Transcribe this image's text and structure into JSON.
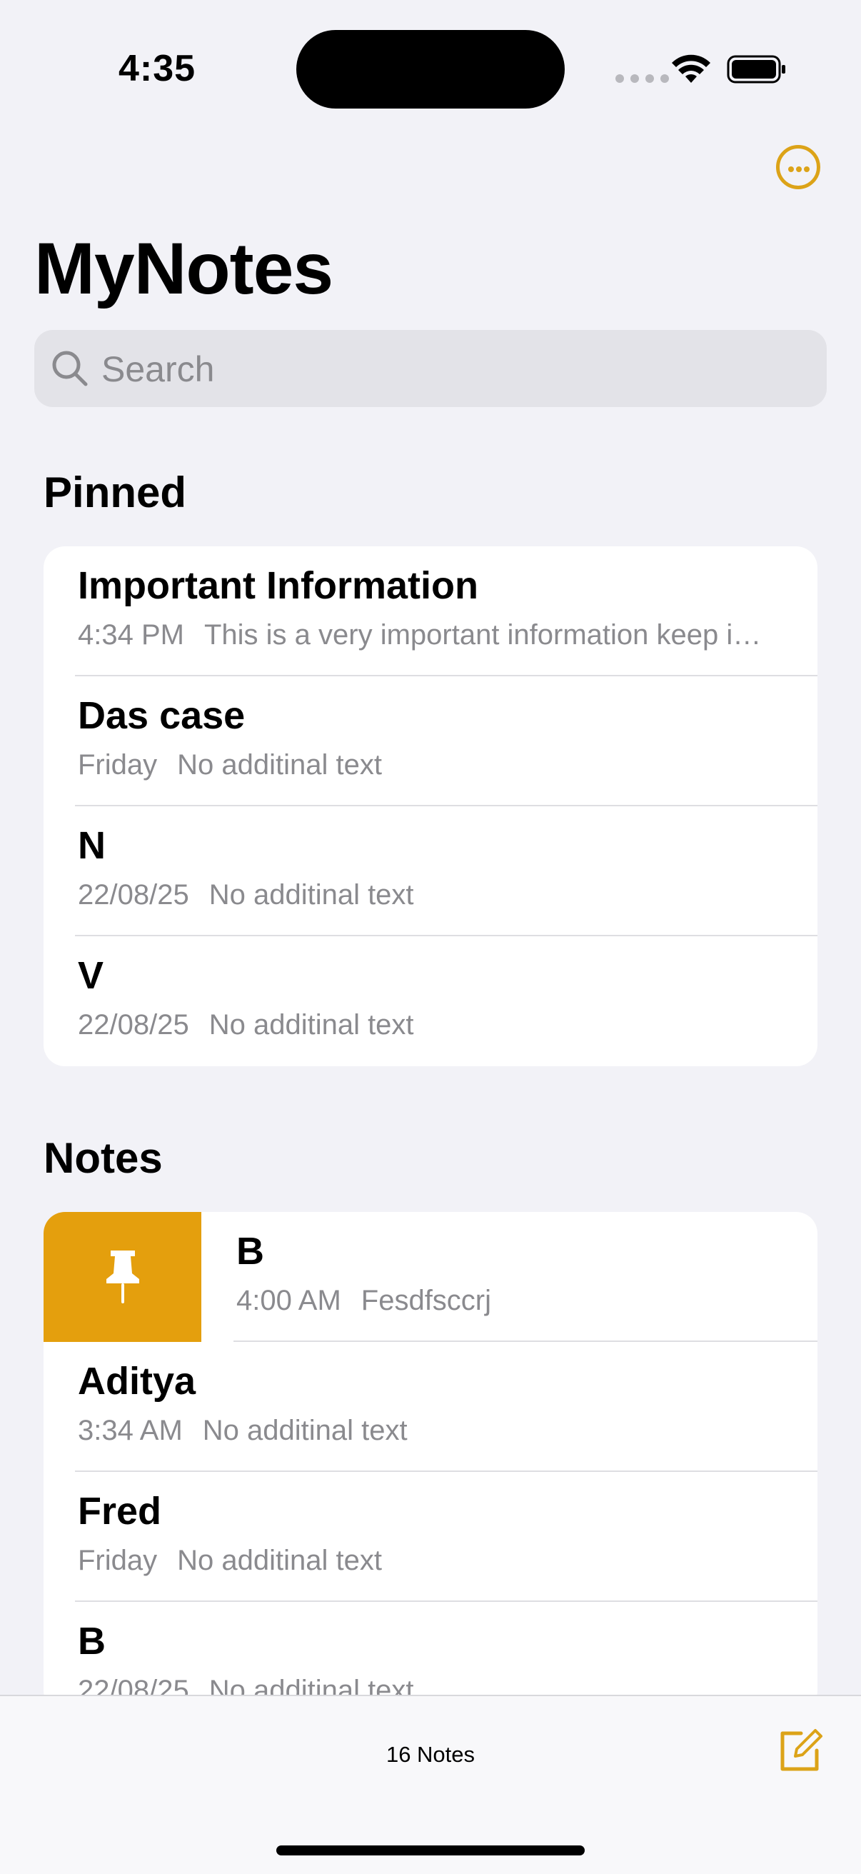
{
  "status_bar": {
    "time": "4:35"
  },
  "header": {
    "title": "MyNotes"
  },
  "search": {
    "placeholder": "Search"
  },
  "pinned": {
    "heading": "Pinned",
    "items": [
      {
        "title": "Important Information",
        "date": "4:34 PM",
        "preview": "This is a very important information keep i…"
      },
      {
        "title": "Das case",
        "date": "Friday",
        "preview": "No additinal text"
      },
      {
        "title": "N",
        "date": "22/08/25",
        "preview": "No additinal text"
      },
      {
        "title": "V",
        "date": "22/08/25",
        "preview": "No additinal text"
      }
    ]
  },
  "notes": {
    "heading": "Notes",
    "items": [
      {
        "title": "B",
        "date": "4:00 AM",
        "preview": "Fesdfsccrj",
        "swipe_action": "pin-icon"
      },
      {
        "title": "Aditya",
        "date": "3:34 AM",
        "preview": "No additinal text"
      },
      {
        "title": "Fred",
        "date": "Friday",
        "preview": "No additinal text"
      },
      {
        "title": "B",
        "date": "22/08/25",
        "preview": "No additinal text"
      }
    ]
  },
  "toolbar": {
    "count_label": "16 Notes",
    "compose_icon": "compose-icon"
  },
  "colors": {
    "accent": "#dca318",
    "pin_action": "#e49f0d",
    "background": "#f2f2f7"
  }
}
